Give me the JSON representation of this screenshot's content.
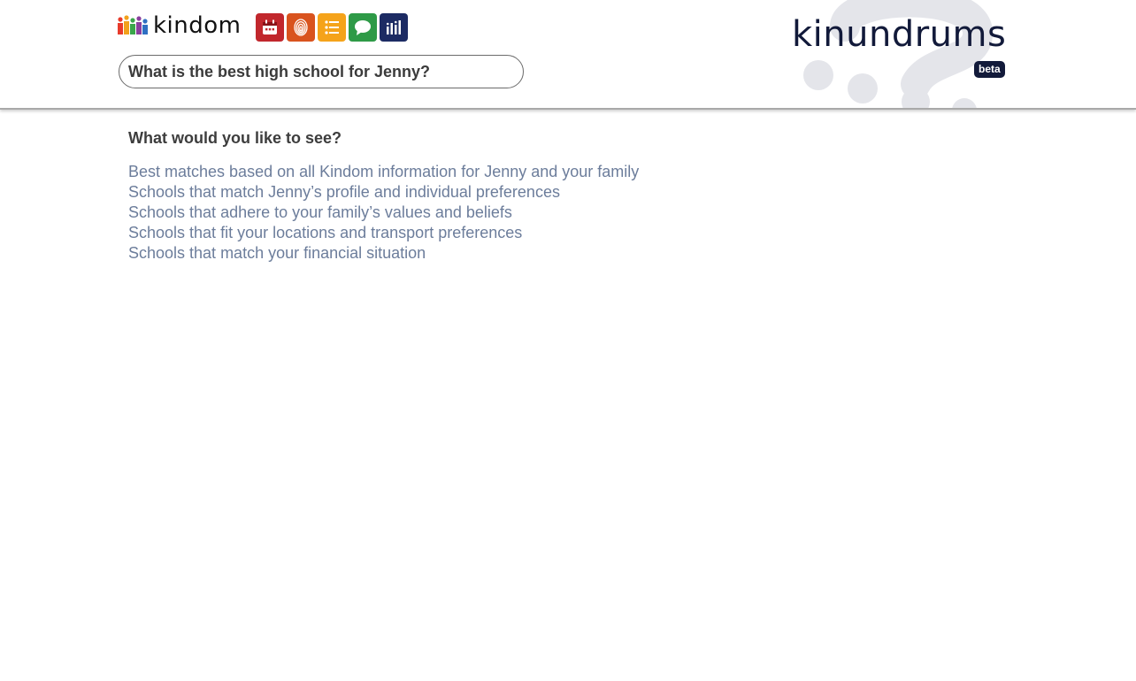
{
  "header": {
    "brand_name": "kindom",
    "brand_icon": "family-figures-icon",
    "app_icons": [
      {
        "name": "calendar-icon",
        "color": "#c1272d"
      },
      {
        "name": "fingerprint-icon",
        "color": "#d9531e"
      },
      {
        "name": "list-icon",
        "color": "#f5a31a"
      },
      {
        "name": "chat-bubble-icon",
        "color": "#2e9a47"
      },
      {
        "name": "bar-chart-icon",
        "color": "#1c2b63"
      }
    ],
    "search_value": "What is the best high school for Jenny?",
    "logo_text": "kinundrums",
    "beta_label": "beta"
  },
  "main": {
    "prompt": "What would you like to see?",
    "options": [
      "Best matches based on all Kindom information for Jenny and your family",
      "Schools that match Jenny’s profile and individual preferences",
      "Schools that adhere to your family’s values and beliefs",
      "Schools that fit your locations and transport preferences",
      "Schools that match your financial situation"
    ]
  },
  "colors": {
    "option_text": "#6c7d9b",
    "logo": "#121a3a",
    "question_mark_watermark": "#e4e5ea"
  }
}
